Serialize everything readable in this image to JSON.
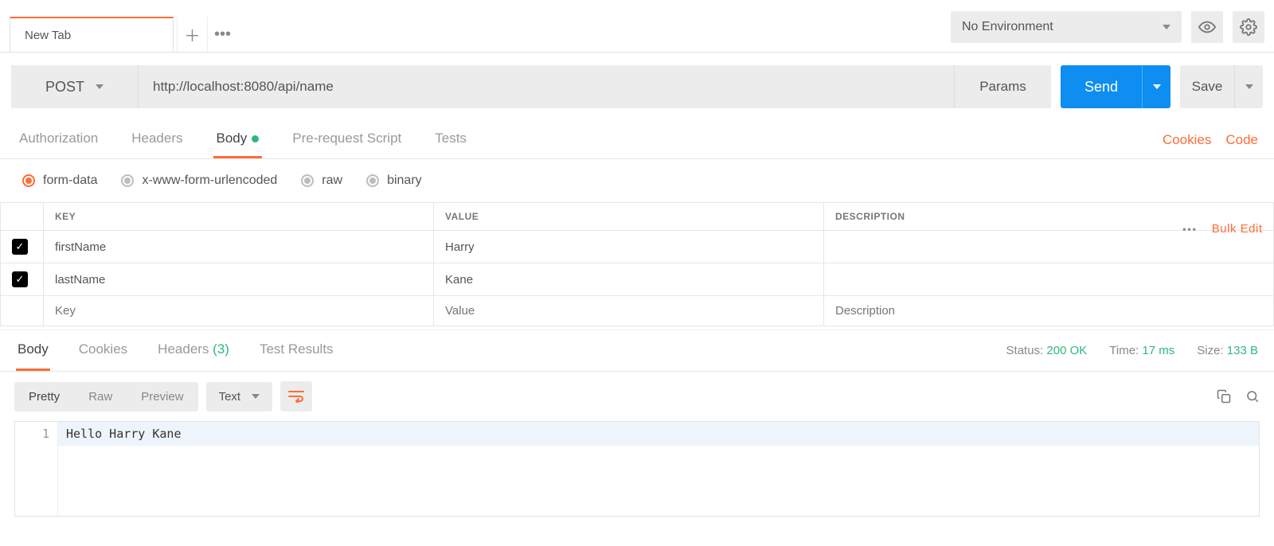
{
  "header": {
    "tab_label": "New Tab",
    "env_label": "No Environment"
  },
  "request": {
    "method": "POST",
    "url": "http://localhost:8080/api/name",
    "params_label": "Params",
    "send_label": "Send",
    "save_label": "Save"
  },
  "req_tabs": {
    "authorization": "Authorization",
    "headers": "Headers",
    "body": "Body",
    "prerequest": "Pre-request Script",
    "tests": "Tests",
    "cookies_link": "Cookies",
    "code_link": "Code"
  },
  "body_types": {
    "formdata": "form-data",
    "urlencoded": "x-www-form-urlencoded",
    "raw": "raw",
    "binary": "binary"
  },
  "fd": {
    "col_key": "Key",
    "col_value": "Value",
    "col_desc": "Description",
    "bulk_edit": "Bulk Edit",
    "rows": [
      {
        "checked": true,
        "key": "firstName",
        "value": "Harry",
        "desc": ""
      },
      {
        "checked": true,
        "key": "lastName",
        "value": "Kane",
        "desc": ""
      }
    ],
    "ph_key": "Key",
    "ph_value": "Value",
    "ph_desc": "Description"
  },
  "resp_tabs": {
    "body": "Body",
    "cookies": "Cookies",
    "headers": "Headers",
    "headers_count": "(3)",
    "tests": "Test Results"
  },
  "resp_meta": {
    "status_lbl": "Status:",
    "status_val": "200 OK",
    "time_lbl": "Time:",
    "time_val": "17 ms",
    "size_lbl": "Size:",
    "size_val": "133 B"
  },
  "resp_view": {
    "pretty": "Pretty",
    "raw": "Raw",
    "preview": "Preview",
    "type": "Text"
  },
  "resp_body": {
    "line_no": "1",
    "content": "Hello Harry Kane"
  }
}
